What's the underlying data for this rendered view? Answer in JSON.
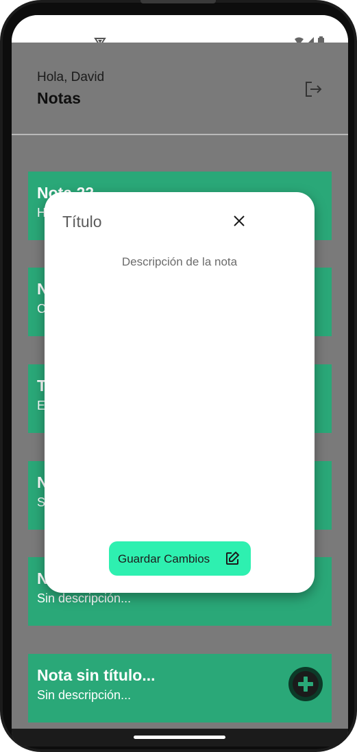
{
  "header": {
    "greeting": "Hola, David",
    "title": "Notas",
    "logout_icon": "logout-icon"
  },
  "notes": [
    {
      "title": "Nota 22",
      "description": "H"
    },
    {
      "title": "N",
      "description": "C"
    },
    {
      "title": "T",
      "description": "E"
    },
    {
      "title": "N",
      "description": "S"
    },
    {
      "title": "N",
      "description": "Sin descripción..."
    },
    {
      "title": "Nota sin título...",
      "description": "Sin descripción..."
    }
  ],
  "dialog": {
    "title_placeholder": "Título",
    "description_placeholder": "Descripción de la nota",
    "close_icon": "close-icon",
    "save_label": "Guardar Cambios",
    "save_icon": "edit-icon"
  },
  "fab": {
    "icon": "add-icon"
  },
  "colors": {
    "note_green": "#2aa878",
    "save_button": "#2ef0b0",
    "scrim": "#7a7a7a"
  }
}
